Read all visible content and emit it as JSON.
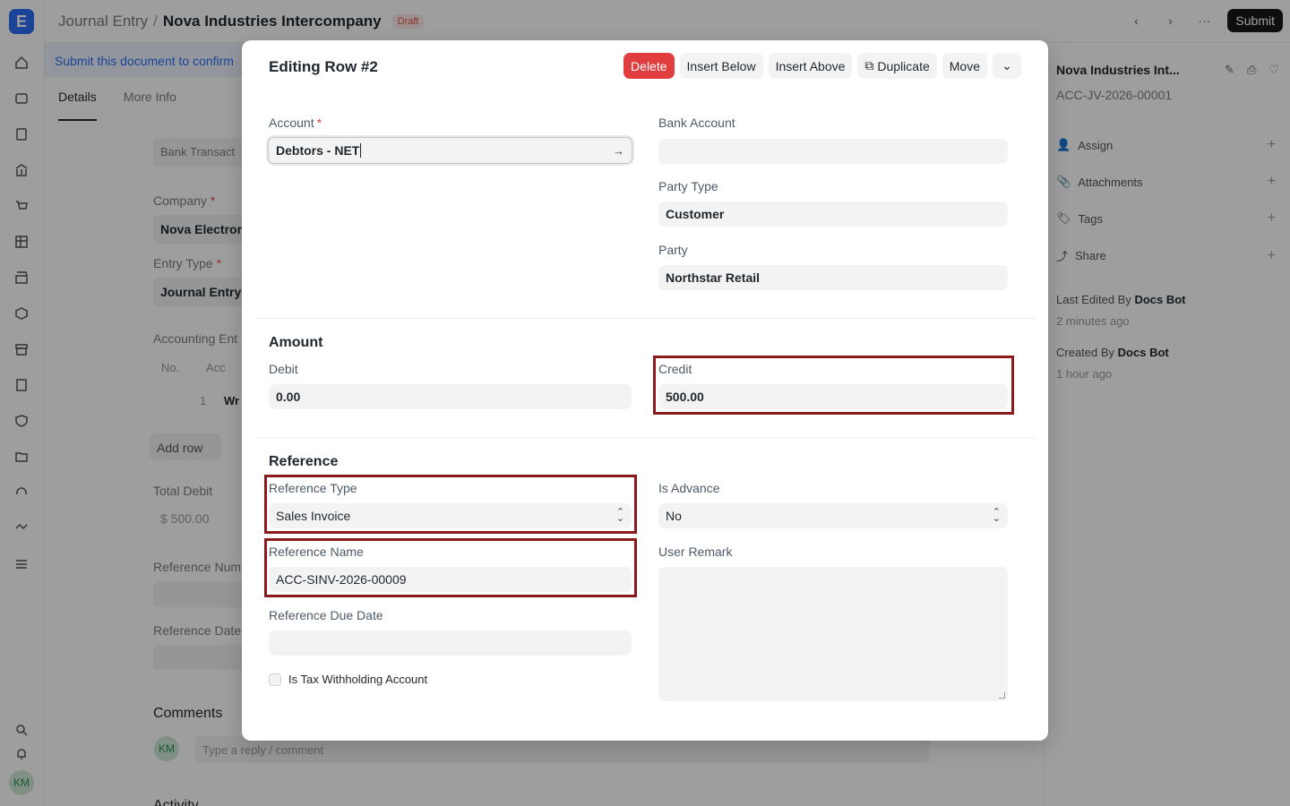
{
  "app": {
    "logo_letter": "E",
    "breadcrumb_parent": "Journal Entry",
    "breadcrumb_sep": "/",
    "doc_title": "Nova Industries Intercompany",
    "status_badge": "Draft",
    "submit_label": "Submit",
    "user_initials": "KM"
  },
  "background": {
    "notice": "Submit this document to confirm",
    "tabs": [
      "Details",
      "More Info"
    ],
    "bank_transaction_label": "Bank Transact",
    "company_label": "Company",
    "company_value": "Nova Electron",
    "entry_type_label": "Entry Type",
    "entry_type_value": "Journal Entry",
    "accounting_entries_label": "Accounting Ent",
    "table_no": "No.",
    "table_acc": "Acc",
    "row_no": "1",
    "row_acc": "Wr",
    "add_row": "Add row",
    "total_debit_label": "Total Debit",
    "total_debit_value": "$ 500.00",
    "ref_num_label": "Reference Num",
    "ref_date_label": "Reference Date",
    "comments_label": "Comments",
    "comment_placeholder": "Type a reply / comment",
    "activity_label": "Activity"
  },
  "right_panel": {
    "title": "Nova Industries Int...",
    "doc_name": "ACC-JV-2026-00001",
    "assign": "Assign",
    "attachments": "Attachments",
    "tags": "Tags",
    "share": "Share",
    "last_edited_prefix": "Last Edited By",
    "last_edited_by": "Docs Bot",
    "last_edited_time": "2 minutes ago",
    "created_prefix": "Created By",
    "created_by": "Docs Bot",
    "created_time": "1 hour ago"
  },
  "modal": {
    "title": "Editing Row #2",
    "actions": {
      "delete": "Delete",
      "insert_below": "Insert Below",
      "insert_above": "Insert Above",
      "duplicate": "Duplicate",
      "move": "Move"
    },
    "account_label": "Account",
    "account_value": "Debtors - NET",
    "bank_account_label": "Bank Account",
    "bank_account_value": "",
    "party_type_label": "Party Type",
    "party_type_value": "Customer",
    "party_label": "Party",
    "party_value": "Northstar Retail",
    "amount_section": "Amount",
    "debit_label": "Debit",
    "debit_value": "0.00",
    "credit_label": "Credit",
    "credit_value": "500.00",
    "reference_section": "Reference",
    "reference_type_label": "Reference Type",
    "reference_type_value": "Sales Invoice",
    "is_advance_label": "Is Advance",
    "is_advance_value": "No",
    "reference_name_label": "Reference Name",
    "reference_name_value": "ACC-SINV-2026-00009",
    "user_remark_label": "User Remark",
    "reference_due_date_label": "Reference Due Date",
    "reference_due_date_value": "",
    "tax_withholding_label": "Is Tax Withholding Account",
    "tax_withholding_checked": false
  },
  "colors": {
    "highlight": "#8b1a1a",
    "delete_button": "#e03e3e",
    "brand": "#2d6df6"
  }
}
